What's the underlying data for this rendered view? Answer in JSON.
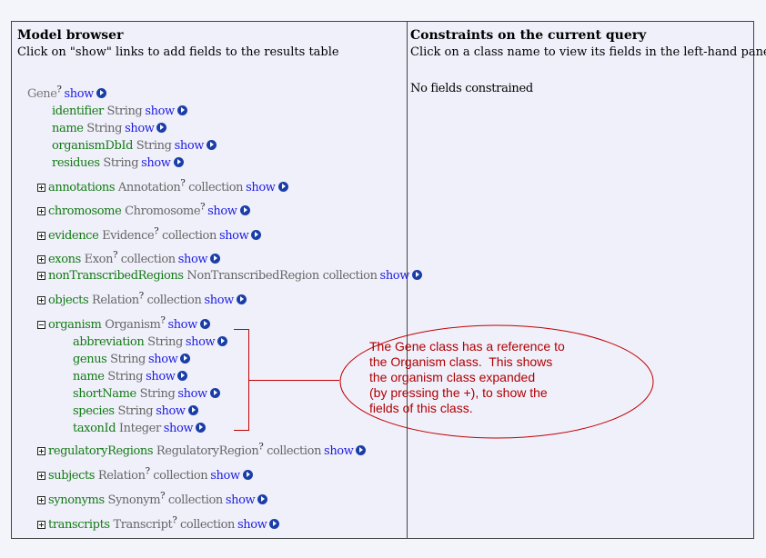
{
  "left_pane": {
    "title": "Model browser",
    "subtitle": "Click on \"show\" links to add fields to the results table"
  },
  "right_pane": {
    "title": "Constraints on the current query",
    "subtitle": "Click on a class name to view its fields in the left-hand pane",
    "empty_message": "No fields constrained"
  },
  "show_label": "show",
  "root": {
    "name": "Gene",
    "help": "?"
  },
  "gene_fields": [
    {
      "name": "identifier",
      "type": "String"
    },
    {
      "name": "name",
      "type": "String"
    },
    {
      "name": "organismDbId",
      "type": "String"
    },
    {
      "name": "residues",
      "type": "String"
    }
  ],
  "references": [
    {
      "name": "annotations",
      "type": "Annotation",
      "help": "?",
      "collection": "collection",
      "expanded": false
    },
    {
      "name": "chromosome",
      "type": "Chromosome",
      "help": "?",
      "collection": "",
      "expanded": false
    },
    {
      "name": "evidence",
      "type": "Evidence",
      "help": "?",
      "collection": "collection",
      "expanded": false
    },
    {
      "name": "exons",
      "type": "Exon",
      "help": "?",
      "collection": "collection",
      "expanded": false
    },
    {
      "name": "nonTranscribedRegions",
      "type": "NonTranscribedRegion",
      "help": "",
      "collection": "collection",
      "expanded": false
    },
    {
      "name": "objects",
      "type": "Relation",
      "help": "?",
      "collection": "collection",
      "expanded": false
    },
    {
      "name": "organism",
      "type": "Organism",
      "help": "?",
      "collection": "",
      "expanded": true
    }
  ],
  "organism_fields": [
    {
      "name": "abbreviation",
      "type": "String"
    },
    {
      "name": "genus",
      "type": "String"
    },
    {
      "name": "name",
      "type": "String"
    },
    {
      "name": "shortName",
      "type": "String"
    },
    {
      "name": "species",
      "type": "String"
    },
    {
      "name": "taxonId",
      "type": "Integer"
    }
  ],
  "references_after": [
    {
      "name": "regulatoryRegions",
      "type": "RegulatoryRegion",
      "help": "?",
      "collection": "collection"
    },
    {
      "name": "subjects",
      "type": "Relation",
      "help": "?",
      "collection": "collection"
    },
    {
      "name": "synonyms",
      "type": "Synonym",
      "help": "?",
      "collection": "collection"
    },
    {
      "name": "transcripts",
      "type": "Transcript",
      "help": "?",
      "collection": "collection"
    }
  ],
  "callout": {
    "text": "The Gene class has a reference to\nthe Organism class.  This shows\nthe organism class expanded\n(by pressing the +), to show the\nfields of this class.",
    "color": "#b00000"
  },
  "icons": {
    "show": "arrow-circle-right-icon",
    "expand": "plus-box-icon",
    "collapse": "minus-box-icon"
  }
}
